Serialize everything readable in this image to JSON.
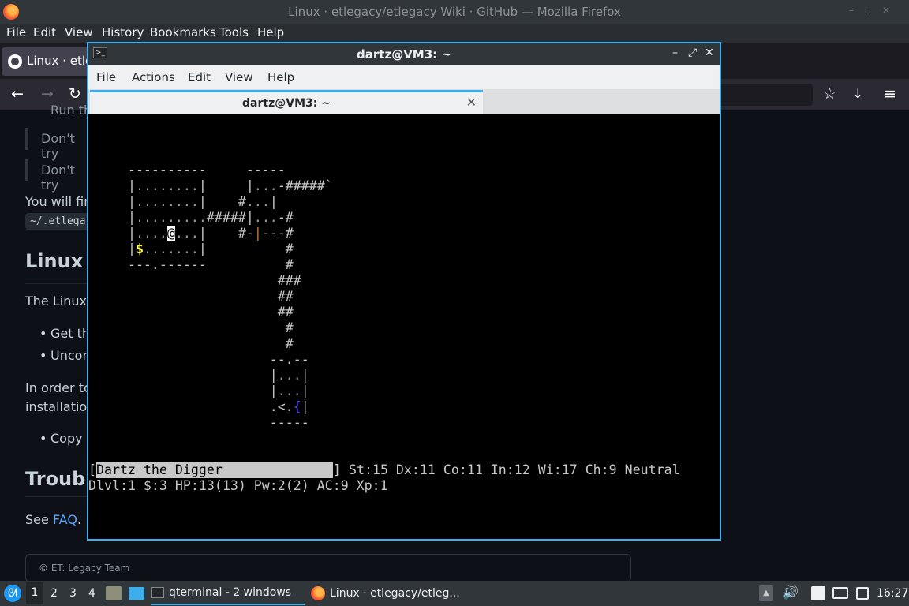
{
  "firefox": {
    "window_title": "Linux · etlegacy/etlegacy Wiki · GitHub — Mozilla Firefox",
    "menu": [
      "File",
      "Edit",
      "View",
      "History",
      "Bookmarks",
      "Tools",
      "Help"
    ],
    "tab_label": "Linux · etleg",
    "page": {
      "partial_top": "Run th",
      "quote1": "Don't try",
      "quote2": "Don't try",
      "you_will_find": "You will find",
      "code_path": "~/.etlega",
      "heading_linux": "Linux A",
      "linux_para": "The Linux a",
      "bullet1": "Get the",
      "bullet2": "Uncom",
      "in_order": "In order to",
      "installation": "installation.",
      "bullet3": "Copy t",
      "heading_trouble": "Trouble",
      "see": "See ",
      "faq_link": "FAQ",
      "faq_period": ".",
      "footer": "© ET: Legacy Team"
    }
  },
  "terminal": {
    "window_title": "dartz@VM3: ~",
    "menu": [
      "File",
      "Actions",
      "Edit",
      "View",
      "Help"
    ],
    "tab_label": "dartz@VM3: ~",
    "status_name": "Dartz the Digger",
    "status_stats": "] St:15 Dx:11 Co:11 In:12 Wi:17 Ch:9 Neutral",
    "status_line2": "Dlvl:1 $:3 HP:13(13) Pw:2(2) AC:9 Xp:1"
  },
  "taskbar": {
    "desktops": [
      "1",
      "2",
      "3",
      "4"
    ],
    "task_terminal": "qterminal - 2 windows",
    "task_firefox": "Linux · etlegacy/etleg...",
    "clock": "16:27"
  }
}
